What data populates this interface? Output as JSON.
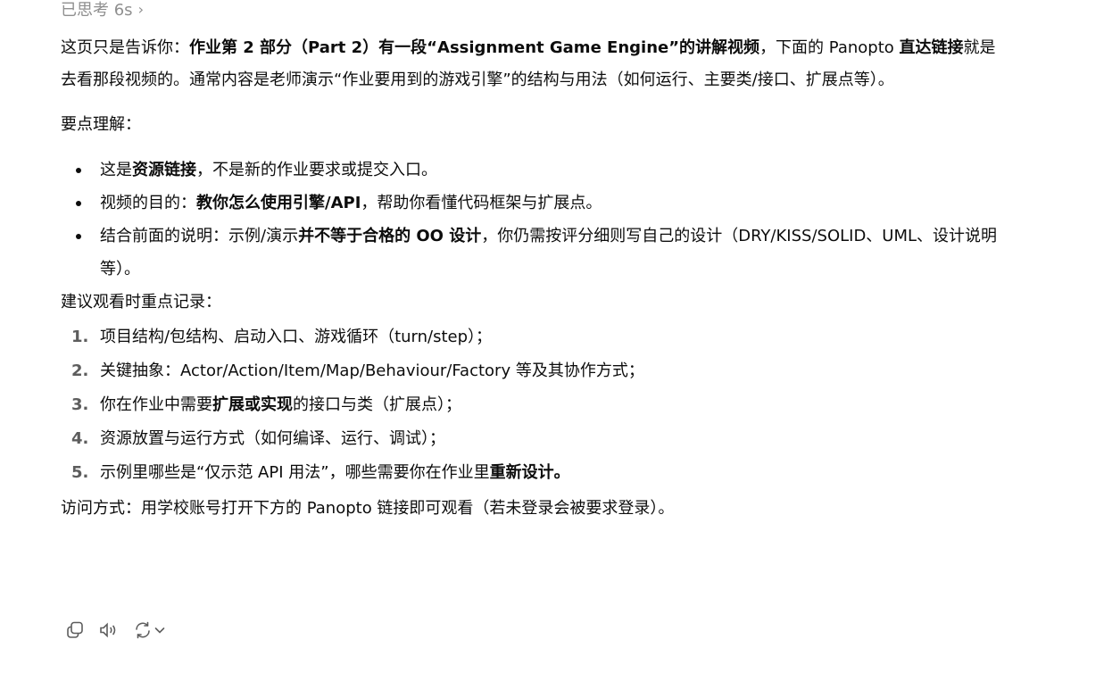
{
  "thought": {
    "label": "已思考 6s"
  },
  "intro": {
    "s1": "这页只是告诉你：",
    "b1": "作业第 2 部分（Part 2）有一段“Assignment Game Engine”的讲解视频",
    "s2": "，下面的 Panopto ",
    "b2": "直达链接",
    "s3": "就是去看那段视频的。通常内容是老师演示“作业要用到的游戏引擎”的结构与用法（如何运行、主要类/接口、扩展点等）。"
  },
  "key_points": {
    "label": "要点理解：",
    "items": [
      {
        "a": "这是",
        "b": "资源链接",
        "c": "，不是新的作业要求或提交入口。"
      },
      {
        "a": "视频的目的：",
        "b": "教你怎么使用引擎/API",
        "c": "，帮助你看懂代码框架与扩展点。"
      },
      {
        "a": "结合前面的说明：示例/演示",
        "b": "并不等于合格的 OO 设计",
        "c": "，你仍需按评分细则写自己的设计（DRY/KISS/SOLID、UML、设计说明等）。"
      }
    ]
  },
  "recommend": {
    "label": "建议观看时重点记录：",
    "items": [
      {
        "num": "1.",
        "a": "项目结构/包结构、启动入口、游戏循环（turn/step）；",
        "b": "",
        "c": ""
      },
      {
        "num": "2.",
        "a": "关键抽象：Actor/Action/Item/Map/Behaviour/Factory 等及其协作方式；",
        "b": "",
        "c": ""
      },
      {
        "num": "3.",
        "a": "你在作业中需要",
        "b": "扩展或实现",
        "c": "的接口与类（扩展点）；"
      },
      {
        "num": "4.",
        "a": "资源放置与运行方式（如何编译、运行、调试）；",
        "b": "",
        "c": ""
      },
      {
        "num": "5.",
        "a": "示例里哪些是“仅示范 API 用法”，哪些需要你在作业里",
        "b": "重新设计。",
        "c": ""
      }
    ]
  },
  "access": {
    "text": "访问方式：用学校账号打开下方的 Panopto 链接即可观看（若未登录会被要求登录）。"
  },
  "actions": {
    "icons": [
      "copy-icon",
      "read-aloud-icon",
      "regenerate-icon",
      "chevron-down-icon"
    ]
  }
}
